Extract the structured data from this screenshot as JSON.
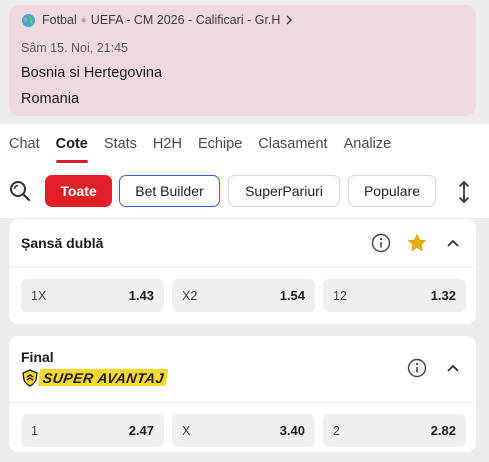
{
  "match": {
    "sport": "Fotbal",
    "competition": "UEFA - CM 2026 - Calificari - Gr.H",
    "datetime": "Sâm 15. Noi, 21:45",
    "home_team": "Bosnia si Hertegovina",
    "away_team": "Romania"
  },
  "tabs": [
    {
      "label": "Chat"
    },
    {
      "label": "Cote",
      "active": true
    },
    {
      "label": "Stats"
    },
    {
      "label": "H2H"
    },
    {
      "label": "Echipe"
    },
    {
      "label": "Clasament"
    },
    {
      "label": "Analize"
    }
  ],
  "filters": {
    "toate": "Toate",
    "bet_builder": "Bet Builder",
    "super_pariuri": "SuperPariuri",
    "populare": "Populare"
  },
  "markets": {
    "double_chance": {
      "title": "Șansă dublă",
      "favorited": true,
      "odds": [
        {
          "label": "1X",
          "value": "1.43"
        },
        {
          "label": "X2",
          "value": "1.54"
        },
        {
          "label": "12",
          "value": "1.32"
        }
      ]
    },
    "final": {
      "title": "Final",
      "badge": "SUPER AVANTAJ",
      "odds": [
        {
          "label": "1",
          "value": "2.47"
        },
        {
          "label": "X",
          "value": "3.40"
        },
        {
          "label": "2",
          "value": "2.82"
        }
      ]
    }
  },
  "colors": {
    "accent": "#e01f26",
    "card_bg": "#eed9de",
    "star": "#e8b400",
    "badge": "#f8d930"
  }
}
